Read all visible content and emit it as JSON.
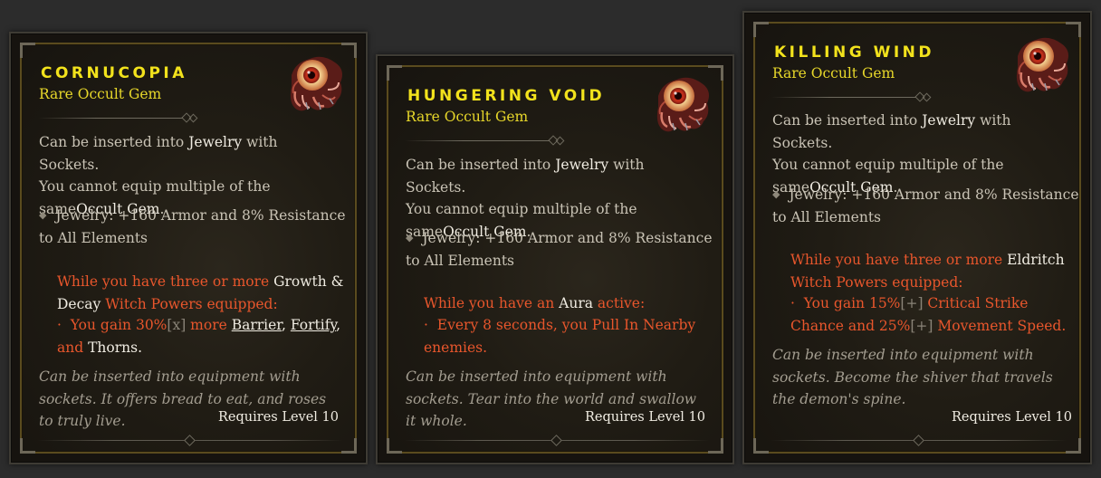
{
  "cards": [
    {
      "title": "CORNUCOPIA",
      "subtitle": "Rare Occult Gem",
      "desc": {
        "p1": "Can be inserted into ",
        "jewelry": "Jewelry",
        "p2": " with Sockets.",
        "line2": "You cannot equip multiple of the",
        "same": "same",
        "occult": "Occult Gem",
        "period": "."
      },
      "stat": "Jewelry: +160 Armor and 8% Resistance to All Elements",
      "condition": {
        "pre": "While you have three or more ",
        "name": "Growth & Decay",
        "post": " Witch Powers equipped:"
      },
      "effect": {
        "a": "You gain 30%",
        "bracket": "[x]",
        "b": " more ",
        "barrier": "Barrier",
        "comma1": ", ",
        "fortify": "Fortify",
        "comma2": ",",
        "and": " and ",
        "thorns": "Thorns",
        "end": "."
      },
      "flavor": "Can be inserted into equipment with sockets. It offers bread to eat, and roses to truly live.",
      "requires": "Requires Level 10",
      "icon": "occult-gem-eye-icon"
    },
    {
      "title": "HUNGERING VOID",
      "subtitle": "Rare Occult Gem",
      "desc": {
        "p1": "Can be inserted into ",
        "jewelry": "Jewelry",
        "p2": " with Sockets.",
        "line2": "You cannot equip multiple of the",
        "same": "same",
        "occult": "Occult Gem",
        "period": "."
      },
      "stat": "Jewelry: +160 Armor and 8% Resistance to All Elements",
      "condition": {
        "pre": "While you have an ",
        "name": "Aura",
        "post": " active:"
      },
      "effect_text": "Every 8 seconds, you Pull In Nearby enemies.",
      "flavor": "Can be inserted into equipment with sockets. Tear into the world and swallow it whole.",
      "requires": "Requires Level 10",
      "icon": "occult-gem-eye-icon"
    },
    {
      "title": "KILLING WIND",
      "subtitle": "Rare Occult Gem",
      "desc": {
        "p1": "Can be inserted into ",
        "jewelry": "Jewelry",
        "p2": " with Sockets.",
        "line2": "You cannot equip multiple of the",
        "same": "same",
        "occult": "Occult Gem",
        "period": "."
      },
      "stat": "Jewelry: +160 Armor and 8% Resistance to All Elements",
      "condition": {
        "pre": "While you have three or more ",
        "name": "Eldritch",
        "post": " Witch Powers equipped:"
      },
      "effect": {
        "a": "You gain 15%",
        "bracket": "[+]",
        "b": " Critical Strike Chance and 25%",
        "bracket2": "[+]",
        "c": " Movement Speed."
      },
      "flavor": "Can be inserted into equipment with sockets. Become the shiver that travels the demon's spine.",
      "requires": "Requires Level 10",
      "icon": "occult-gem-eye-icon"
    }
  ],
  "colors": {
    "title": "#f2e21c",
    "subtitle": "#e7d72a",
    "highlight": "#e8562c",
    "body": "#c9c3b5",
    "flavor": "#a39d90"
  }
}
